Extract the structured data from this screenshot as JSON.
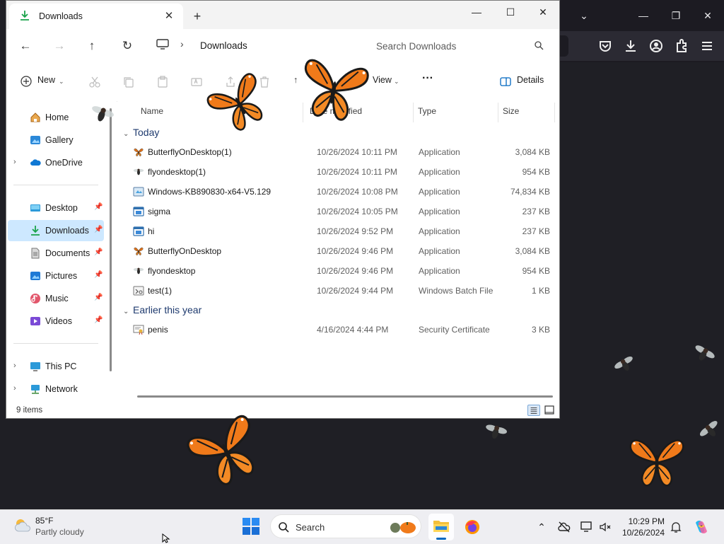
{
  "explorer": {
    "tab": {
      "title": "Downloads",
      "close_glyph": "✕"
    },
    "new_tab_glyph": "+",
    "controls": {
      "minimize": "—",
      "maximize": "☐",
      "close": "✕"
    },
    "address": {
      "separator": "›",
      "crumb": "Downloads"
    },
    "search": {
      "placeholder": "Search Downloads"
    },
    "commandbar": {
      "new_label": "New",
      "view_label": "View",
      "more_label": "···",
      "details_label": "Details"
    },
    "sidebar": {
      "items": [
        {
          "label": "Home",
          "icon": "home-icon"
        },
        {
          "label": "Gallery",
          "icon": "gallery-icon"
        },
        {
          "label": "OneDrive",
          "icon": "onedrive-icon"
        },
        {
          "label": "Desktop",
          "icon": "desktop-icon"
        },
        {
          "label": "Downloads",
          "icon": "downloads-icon"
        },
        {
          "label": "Documents",
          "icon": "documents-icon"
        },
        {
          "label": "Pictures",
          "icon": "pictures-icon"
        },
        {
          "label": "Music",
          "icon": "music-icon"
        },
        {
          "label": "Videos",
          "icon": "videos-icon"
        },
        {
          "label": "This PC",
          "icon": "this-pc-icon"
        },
        {
          "label": "Network",
          "icon": "network-icon"
        }
      ]
    },
    "columns": {
      "name": "Name",
      "date": "Date modified",
      "type": "Type",
      "size": "Size"
    },
    "groups": [
      {
        "title": "Today",
        "files": [
          {
            "name": "ButterflyOnDesktop(1)",
            "date": "10/26/2024 10:11 PM",
            "type": "Application",
            "size": "3,084 KB",
            "icon": "butterfly-app-icon"
          },
          {
            "name": "flyondesktop(1)",
            "date": "10/26/2024 10:11 PM",
            "type": "Application",
            "size": "954 KB",
            "icon": "fly-app-icon"
          },
          {
            "name": "Windows-KB890830-x64-V5.129",
            "date": "10/26/2024 10:08 PM",
            "type": "Application",
            "size": "74,834 KB",
            "icon": "installer-icon"
          },
          {
            "name": "sigma",
            "date": "10/26/2024 10:05 PM",
            "type": "Application",
            "size": "237 KB",
            "icon": "app-window-icon"
          },
          {
            "name": "hi",
            "date": "10/26/2024 9:52 PM",
            "type": "Application",
            "size": "237 KB",
            "icon": "app-window-icon"
          },
          {
            "name": "ButterflyOnDesktop",
            "date": "10/26/2024 9:46 PM",
            "type": "Application",
            "size": "3,084 KB",
            "icon": "butterfly-app-icon"
          },
          {
            "name": "flyondesktop",
            "date": "10/26/2024 9:46 PM",
            "type": "Application",
            "size": "954 KB",
            "icon": "fly-app-icon"
          },
          {
            "name": "test(1)",
            "date": "10/26/2024 9:44 PM",
            "type": "Windows Batch File",
            "size": "1 KB",
            "icon": "batch-file-icon"
          }
        ]
      },
      {
        "title": "Earlier this year",
        "files": [
          {
            "name": "penis",
            "date": "4/16/2024 4:44 PM",
            "type": "Security Certificate",
            "size": "3 KB",
            "icon": "certificate-icon"
          }
        ]
      }
    ],
    "status": {
      "item_count": "9 items"
    }
  },
  "taskbar": {
    "weather": {
      "temp": "85°F",
      "condition": "Partly cloudy"
    },
    "search_label": "Search",
    "clock": {
      "time": "10:29 PM",
      "date": "10/26/2024"
    }
  },
  "colors": {
    "accent": "#0067c0",
    "selection": "#cde8ff",
    "group_header": "#1e3a6e",
    "desktop_bg": "#1f1f25",
    "butterfly_orange": "#f07a1a"
  }
}
